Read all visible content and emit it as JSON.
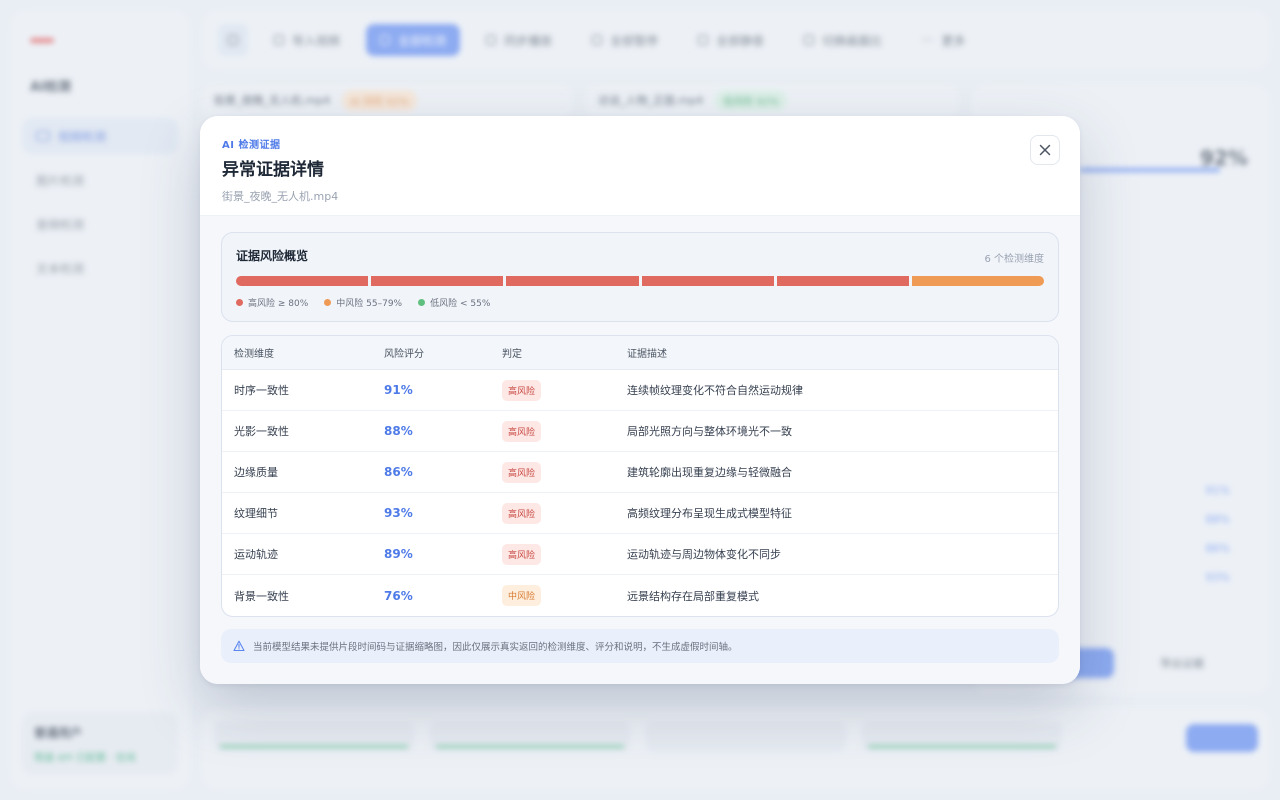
{
  "modal": {
    "eyebrow": "AI 检测证据",
    "title": "异常证据详情",
    "file_name": "街景_夜晚_无人机.mp4",
    "close_label": "×"
  },
  "overview": {
    "title": "证据风险概览",
    "count_label": "6 个检测维度",
    "segments": [
      {
        "level": "high"
      },
      {
        "level": "high"
      },
      {
        "level": "high"
      },
      {
        "level": "high"
      },
      {
        "level": "high"
      },
      {
        "level": "mid"
      }
    ],
    "legend": [
      {
        "label": "高风险 ≥ 80%",
        "color": "#e06a5f"
      },
      {
        "label": "中风险 55–79%",
        "color": "#ef9a55"
      },
      {
        "label": "低风险 < 55%",
        "color": "#5fbf7f"
      }
    ]
  },
  "colors": {
    "high": "#e06a5f",
    "mid": "#ef9a55",
    "low": "#5fbf7f",
    "accent": "#4f7be8"
  },
  "table": {
    "headers": [
      "检测维度",
      "风险评分",
      "判定",
      "证据描述"
    ],
    "rows": [
      {
        "dimension": "时序一致性",
        "score": "91%",
        "verdict": "高风险",
        "level": "high",
        "description": "连续帧纹理变化不符合自然运动规律"
      },
      {
        "dimension": "光影一致性",
        "score": "88%",
        "verdict": "高风险",
        "level": "high",
        "description": "局部光照方向与整体环境光不一致"
      },
      {
        "dimension": "边缘质量",
        "score": "86%",
        "verdict": "高风险",
        "level": "high",
        "description": "建筑轮廓出现重复边缘与轻微融合"
      },
      {
        "dimension": "纹理细节",
        "score": "93%",
        "verdict": "高风险",
        "level": "high",
        "description": "高频纹理分布呈现生成式模型特征"
      },
      {
        "dimension": "运动轨迹",
        "score": "89%",
        "verdict": "高风险",
        "level": "high",
        "description": "运动轨迹与周边物体变化不同步"
      },
      {
        "dimension": "背景一致性",
        "score": "76%",
        "verdict": "中风险",
        "level": "mid",
        "description": "远景结构存在局部重复模式"
      }
    ]
  },
  "notice": {
    "icon": "warning-triangle-icon",
    "text": "当前模型结果未提供片段时间码与证据缩略图，因此仅展示真实返回的检测维度、评分和说明，不生成虚假时间轴。"
  },
  "background": {
    "brand": "AI检测",
    "nav": [
      "视频检测",
      "图片检测",
      "音频检测",
      "文本检测"
    ],
    "user_name": "普通用户",
    "user_status": "限速 API 已配置 · 在线",
    "toolbar": [
      "导入视频",
      "全部检测",
      "同步播放",
      "全部暂停",
      "全部静音",
      "切换画面比",
      "更多"
    ],
    "files": [
      {
        "name": "街景_夜晚_无人机.mp4",
        "badge": "AI 风险 92%"
      },
      {
        "name": "访谈_人物_正面.mp4",
        "badge": "低风险 92%"
      }
    ],
    "right_panel_score": "92%",
    "right_panel_values": [
      "91%",
      "88%",
      "86%",
      "93%"
    ],
    "right_panel_buttons": [
      "导出证据"
    ]
  }
}
